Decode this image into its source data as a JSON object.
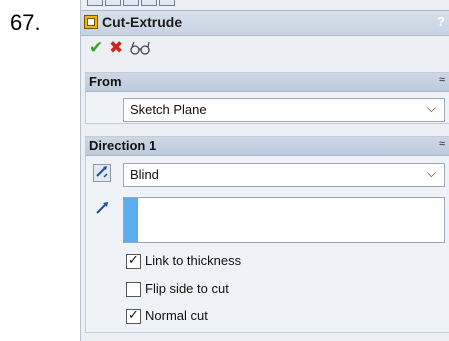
{
  "step": {
    "number": "67."
  },
  "window": {
    "title": "Cut-Extrude",
    "help": "?"
  },
  "actions": {
    "ok_icon": "✔",
    "cancel_icon": "✖",
    "preview_icon": "glasses-icon"
  },
  "from": {
    "title": "From",
    "collapse": "≈",
    "value": "Sketch Plane",
    "arrow": "⌵"
  },
  "direction1": {
    "title": "Direction 1",
    "collapse": "≈",
    "end_condition": "Blind",
    "arrow": "⌵",
    "checks": [
      {
        "label": "Link to thickness",
        "checked": true
      },
      {
        "label": "Flip side to cut",
        "checked": false
      },
      {
        "label": "Normal cut",
        "checked": true
      }
    ]
  },
  "colors": {
    "accent": "#5aaef0",
    "ok": "#3aa22b",
    "cancel": "#d0261d"
  }
}
